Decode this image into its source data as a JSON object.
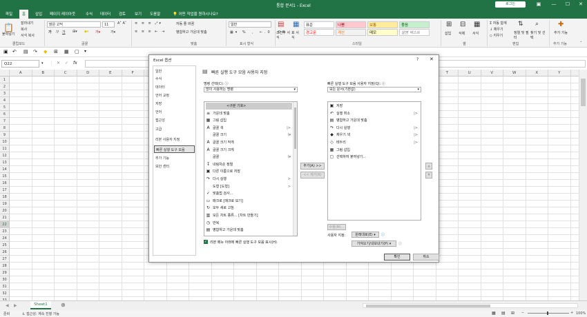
{
  "app": {
    "title": "통합 문서1 - Excel",
    "login": "로그인"
  },
  "window_controls": [
    "▣",
    "—",
    "☐",
    "✕"
  ],
  "tabs": [
    "파일",
    "홈",
    "삽입",
    "페이지 레이아웃",
    "수식",
    "데이터",
    "검토",
    "보기",
    "도움말",
    "💡 어떤 작업을 원하시나요?"
  ],
  "ribbon": {
    "clipboard": {
      "paste": "붙여넣기",
      "cut": "잘라내기",
      "copy": "복사",
      "format_painter": "서식 복사",
      "group": "클립보드"
    },
    "font": {
      "name": "맑은 고딕",
      "size": "11",
      "group": "글꼴"
    },
    "alignment": {
      "wrap": "자동 줄 바꿈",
      "merge": "병합하고 가운데 맞춤",
      "group": "맞춤"
    },
    "number": {
      "format": "일반",
      "group": "표시 형식"
    },
    "styles": {
      "conditional": "조건부 서식",
      "table": "표 서식",
      "group": "스타일",
      "cells": [
        "표준",
        "나쁨",
        "보통",
        "좋음",
        "경고문",
        "계산",
        "메모",
        "설명 텍스트"
      ]
    },
    "cells": {
      "insert": "삽입",
      "delete": "삭제",
      "format": "서식",
      "group": "셀"
    },
    "editing": {
      "autosum": "자동 합계",
      "fill": "채우기",
      "clear": "지우기",
      "sort": "정렬 및 필터",
      "find": "찾기 및 선택",
      "group": "편집"
    },
    "addins": {
      "label": "추가 기능",
      "group": "추가 기능"
    }
  },
  "formula_bar": {
    "name_box": "Q22",
    "fx": "fx"
  },
  "columns": [
    "A",
    "B",
    "C",
    "D",
    "E",
    "F",
    "G",
    "H",
    "I",
    "J",
    "K",
    "L",
    "M",
    "N",
    "O",
    "P",
    "Q",
    "R",
    "S",
    "T",
    "U",
    "V",
    "W",
    "X",
    "Y",
    "Z"
  ],
  "rows": [
    "1",
    "2",
    "3",
    "4",
    "5",
    "6",
    "7",
    "8",
    "9",
    "10",
    "11",
    "12",
    "13",
    "14",
    "15",
    "16",
    "17",
    "18",
    "19",
    "20",
    "21",
    "22",
    "23",
    "24",
    "25",
    "26",
    "27",
    "28",
    "29",
    "30",
    "31",
    "32",
    "33"
  ],
  "sheet_tabs": [
    "Sheet1"
  ],
  "status": {
    "ready": "준비",
    "accessibility": "접근성: 계속 진행 가능",
    "zoom": "100%"
  },
  "dialog": {
    "title": "Excel 옵션",
    "help": "?",
    "close": "✕",
    "nav": [
      "일반",
      "수식",
      "데이터",
      "언어 교정",
      "저장",
      "언어",
      "접근성",
      "고급",
      "리본 사용자 지정",
      "빠른 실행 도구 모음",
      "추가 기능",
      "보안 센터"
    ],
    "nav_selected": "빠른 실행 도구 모음",
    "heading": "빠른 실행 도구 모음 사용자 지정",
    "choose_label": "명령 선택(C): ⓘ",
    "choose_value": "많이 사용하는 명령",
    "customize_label": "빠른 실행 도구 모음 사용자 지정(Q): ⓘ",
    "customize_value": "모든 문서(기본값)",
    "commands": [
      {
        "icon": "",
        "label": "<구분 기호>",
        "arrow": ""
      },
      {
        "icon": "≡",
        "label": "가운데 맞춤",
        "arrow": ""
      },
      {
        "icon": "▦",
        "label": "그림 삽입",
        "arrow": ""
      },
      {
        "icon": "A",
        "label": "글꼴 색",
        "arrow": "|>"
      },
      {
        "icon": "",
        "label": "글꼴 크기",
        "arrow": "I▾"
      },
      {
        "icon": "A",
        "label": "글꼴 크기 작게",
        "arrow": ""
      },
      {
        "icon": "A",
        "label": "글꼴 크기 크게",
        "arrow": ""
      },
      {
        "icon": "",
        "label": "글꼴",
        "arrow": "I▾"
      },
      {
        "icon": "↧",
        "label": "내림차순 정렬",
        "arrow": ""
      },
      {
        "icon": "▣",
        "label": "다른 이름으로 저장",
        "arrow": ""
      },
      {
        "icon": "↷",
        "label": "다시 실행",
        "arrow": ">"
      },
      {
        "icon": "",
        "label": "도형 [도형]",
        "arrow": ">"
      },
      {
        "icon": "✓",
        "label": "맞춤법 검사...",
        "arrow": ""
      },
      {
        "icon": "▭",
        "label": "매크로 [매크로 보기]",
        "arrow": ""
      },
      {
        "icon": "↻",
        "label": "모두 새로 고침",
        "arrow": ""
      },
      {
        "icon": "▥",
        "label": "모든 차트 종류... [차트 만들기]",
        "arrow": ""
      },
      {
        "icon": "◷",
        "label": "반복",
        "arrow": ""
      },
      {
        "icon": "▤",
        "label": "병합하고 가운데 맞춤",
        "arrow": ""
      }
    ],
    "qat_items": [
      {
        "icon": "▣",
        "label": "저장",
        "arrow": ""
      },
      {
        "icon": "↶",
        "label": "실행 취소",
        "arrow": "|>"
      },
      {
        "icon": "▤",
        "label": "병합하고 가운데 맞춤",
        "arrow": ""
      },
      {
        "icon": "↷",
        "label": "다시 실행",
        "arrow": "|>"
      },
      {
        "icon": "◆",
        "label": "채우기 색",
        "arrow": "|>"
      },
      {
        "icon": "◇",
        "label": "테두리",
        "arrow": "|>"
      },
      {
        "icon": "▦",
        "label": "그림 삽입",
        "arrow": ""
      },
      {
        "icon": "▢",
        "label": "선택하여 붙여넣기...",
        "arrow": ""
      }
    ],
    "add_btn": "추가(A) >>",
    "remove_btn": "<< 제거(R)",
    "modify_btn": "수정(M)...",
    "custom_label": "사용자 지정:",
    "reset_btn": "원래대로(E) ▾",
    "import_btn": "가져오기/내보내기(P) ▾",
    "show_below": "리본 메뉴 아래에 빠른 실행 도구 모음 표시(H)",
    "ok": "확인",
    "cancel": "취소"
  }
}
